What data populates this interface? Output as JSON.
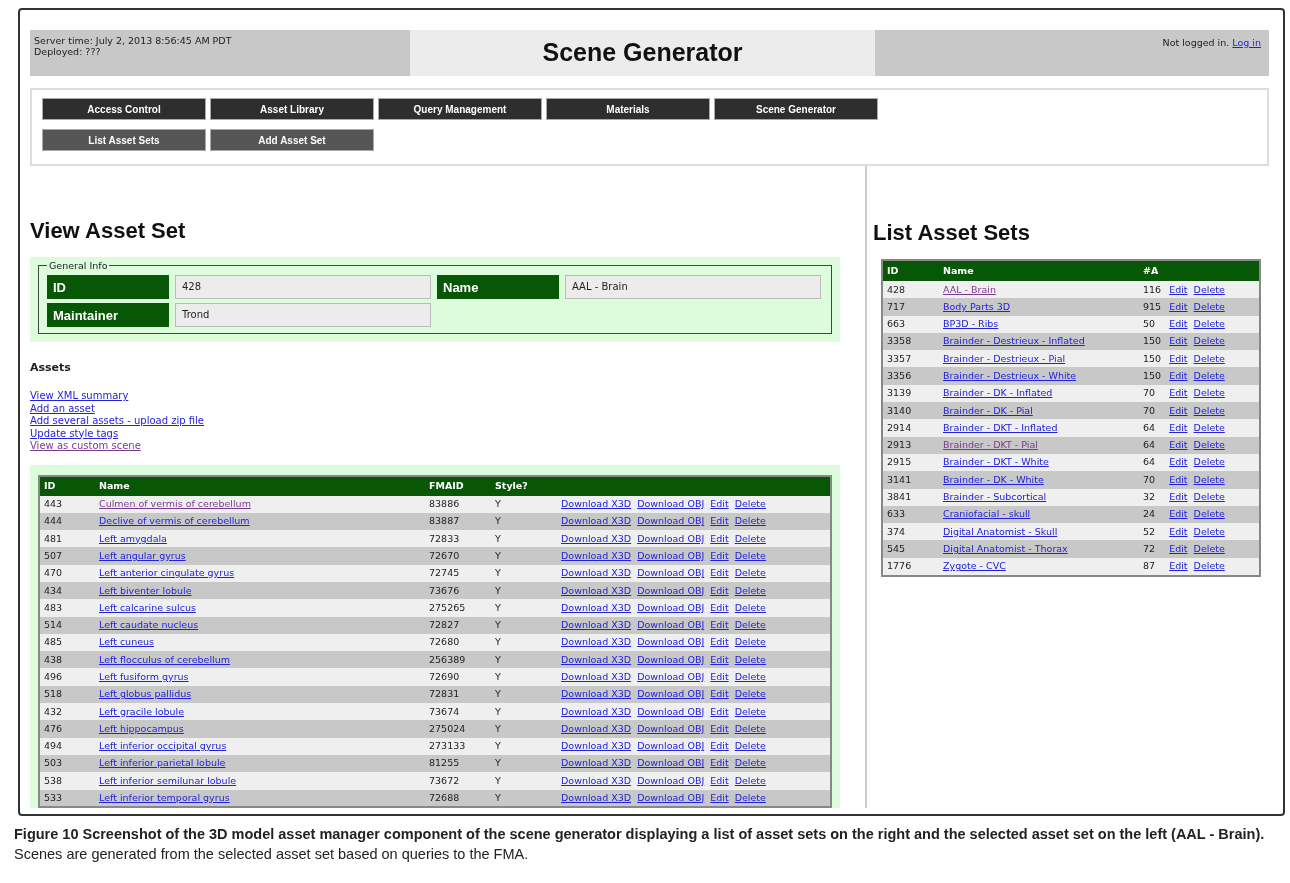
{
  "header": {
    "server_time": "Server time: July 2, 2013 8:56:45 AM PDT",
    "deployed": "Deployed: ???",
    "title": "Scene Generator",
    "login_status": "Not logged in.",
    "login_link": "Log in"
  },
  "nav": {
    "main": [
      "Access Control",
      "Asset Library",
      "Query Management",
      "Materials",
      "Scene Generator"
    ],
    "sub": [
      "List Asset Sets",
      "Add Asset Set"
    ]
  },
  "view": {
    "heading": "View Asset Set",
    "general_info": {
      "legend": "General Info",
      "fields": [
        {
          "label": "ID",
          "value": "428"
        },
        {
          "label": "Name",
          "value": "AAL - Brain"
        },
        {
          "label": "Maintainer",
          "value": "Trond"
        }
      ]
    },
    "assets_heading": "Assets",
    "links": [
      {
        "text": "View XML summary",
        "visited": false
      },
      {
        "text": "Add an asset",
        "visited": false
      },
      {
        "text": "Add several assets - upload zip file",
        "visited": false
      },
      {
        "text": "Update style tags",
        "visited": false
      },
      {
        "text": "View as custom scene",
        "visited": true
      }
    ],
    "table": {
      "columns": [
        "ID",
        "Name",
        "FMAID",
        "Style?"
      ],
      "rows": [
        {
          "id": "443",
          "name": "Culmen of vermis of cerebellum",
          "fmaid": "83886",
          "style": "Y",
          "visited": true,
          "actions": [
            "Download X3D",
            "Download OBJ",
            "Edit",
            "Delete"
          ]
        },
        {
          "id": "444",
          "name": "Declive of vermis of cerebellum",
          "fmaid": "83887",
          "style": "Y",
          "visited": false,
          "actions": [
            "Download X3D",
            "Download OBJ",
            "Edit",
            "Delete"
          ]
        },
        {
          "id": "481",
          "name": "Left amygdala",
          "fmaid": "72833",
          "style": "Y",
          "visited": false,
          "actions": [
            "Download X3D",
            "Download OBJ",
            "Edit",
            "Delete"
          ]
        },
        {
          "id": "507",
          "name": "Left angular gyrus",
          "fmaid": "72670",
          "style": "Y",
          "visited": false,
          "actions": [
            "Download X3D",
            "Download OBJ",
            "Edit",
            "Delete"
          ]
        },
        {
          "id": "470",
          "name": "Left anterior cingulate gyrus",
          "fmaid": "72745",
          "style": "Y",
          "visited": false,
          "actions": [
            "Download X3D",
            "Download OBJ",
            "Edit",
            "Delete"
          ]
        },
        {
          "id": "434",
          "name": "Left biventer lobule",
          "fmaid": "73676",
          "style": "Y",
          "visited": false,
          "actions": [
            "Download X3D",
            "Download OBJ",
            "Edit",
            "Delete"
          ]
        },
        {
          "id": "483",
          "name": "Left calcarine sulcus",
          "fmaid": "275265",
          "style": "Y",
          "visited": false,
          "actions": [
            "Download X3D",
            "Download OBJ",
            "Edit",
            "Delete"
          ]
        },
        {
          "id": "514",
          "name": "Left caudate nucleus",
          "fmaid": "72827",
          "style": "Y",
          "visited": false,
          "actions": [
            "Download X3D",
            "Download OBJ",
            "Edit",
            "Delete"
          ]
        },
        {
          "id": "485",
          "name": "Left cuneus",
          "fmaid": "72680",
          "style": "Y",
          "visited": false,
          "actions": [
            "Download X3D",
            "Download OBJ",
            "Edit",
            "Delete"
          ]
        },
        {
          "id": "438",
          "name": "Left flocculus of cerebellum",
          "fmaid": "256389",
          "style": "Y",
          "visited": false,
          "actions": [
            "Download X3D",
            "Download OBJ",
            "Edit",
            "Delete"
          ]
        },
        {
          "id": "496",
          "name": "Left fusiform gyrus",
          "fmaid": "72690",
          "style": "Y",
          "visited": false,
          "actions": [
            "Download X3D",
            "Download OBJ",
            "Edit",
            "Delete"
          ]
        },
        {
          "id": "518",
          "name": "Left globus pallidus",
          "fmaid": "72831",
          "style": "Y",
          "visited": false,
          "actions": [
            "Download X3D",
            "Download OBJ",
            "Edit",
            "Delete"
          ]
        },
        {
          "id": "432",
          "name": "Left gracile lobule",
          "fmaid": "73674",
          "style": "Y",
          "visited": false,
          "actions": [
            "Download X3D",
            "Download OBJ",
            "Edit",
            "Delete"
          ]
        },
        {
          "id": "476",
          "name": "Left hippocampus",
          "fmaid": "275024",
          "style": "Y",
          "visited": false,
          "actions": [
            "Download X3D",
            "Download OBJ",
            "Edit",
            "Delete"
          ]
        },
        {
          "id": "494",
          "name": "Left inferior occipital gyrus",
          "fmaid": "273133",
          "style": "Y",
          "visited": false,
          "actions": [
            "Download X3D",
            "Download OBJ",
            "Edit",
            "Delete"
          ]
        },
        {
          "id": "503",
          "name": "Left inferior parietal lobule",
          "fmaid": "81255",
          "style": "Y",
          "visited": false,
          "actions": [
            "Download X3D",
            "Download OBJ",
            "Edit",
            "Delete"
          ]
        },
        {
          "id": "538",
          "name": "Left inferior semilunar lobule",
          "fmaid": "73672",
          "style": "Y",
          "visited": false,
          "actions": [
            "Download X3D",
            "Download OBJ",
            "Edit",
            "Delete"
          ]
        },
        {
          "id": "533",
          "name": "Left inferior temporal gyrus",
          "fmaid": "72688",
          "style": "Y",
          "visited": false,
          "actions": [
            "Download X3D",
            "Download OBJ",
            "Edit",
            "Delete"
          ]
        }
      ]
    }
  },
  "list": {
    "heading": "List Asset Sets",
    "table": {
      "columns": [
        "ID",
        "Name",
        "#A"
      ],
      "rows": [
        {
          "id": "428",
          "name": "AAL - Brain",
          "count": "116",
          "visited": true,
          "actions": [
            "Edit",
            "Delete"
          ]
        },
        {
          "id": "717",
          "name": "Body Parts 3D",
          "count": "915",
          "visited": false,
          "actions": [
            "Edit",
            "Delete"
          ]
        },
        {
          "id": "663",
          "name": "BP3D - Ribs",
          "count": "50",
          "visited": false,
          "actions": [
            "Edit",
            "Delete"
          ]
        },
        {
          "id": "3358",
          "name": "Brainder - Destrieux - Inflated",
          "count": "150",
          "visited": false,
          "actions": [
            "Edit",
            "Delete"
          ]
        },
        {
          "id": "3357",
          "name": "Brainder - Destrieux - Pial",
          "count": "150",
          "visited": false,
          "actions": [
            "Edit",
            "Delete"
          ]
        },
        {
          "id": "3356",
          "name": "Brainder - Destrieux - White",
          "count": "150",
          "visited": false,
          "actions": [
            "Edit",
            "Delete"
          ]
        },
        {
          "id": "3139",
          "name": "Brainder - DK - Inflated",
          "count": "70",
          "visited": false,
          "actions": [
            "Edit",
            "Delete"
          ]
        },
        {
          "id": "3140",
          "name": "Brainder - DK - Pial",
          "count": "70",
          "visited": false,
          "actions": [
            "Edit",
            "Delete"
          ]
        },
        {
          "id": "2914",
          "name": "Brainder - DKT - Inflated",
          "count": "64",
          "visited": false,
          "actions": [
            "Edit",
            "Delete"
          ]
        },
        {
          "id": "2913",
          "name": "Brainder - DKT - Pial",
          "count": "64",
          "visited": true,
          "actions": [
            "Edit",
            "Delete"
          ]
        },
        {
          "id": "2915",
          "name": "Brainder - DKT - White",
          "count": "64",
          "visited": false,
          "actions": [
            "Edit",
            "Delete"
          ]
        },
        {
          "id": "3141",
          "name": "Brainder - DK - White",
          "count": "70",
          "visited": false,
          "actions": [
            "Edit",
            "Delete"
          ]
        },
        {
          "id": "3841",
          "name": "Brainder - Subcortical",
          "count": "32",
          "visited": false,
          "actions": [
            "Edit",
            "Delete"
          ]
        },
        {
          "id": "633",
          "name": "Craniofacial - skull",
          "count": "24",
          "visited": false,
          "actions": [
            "Edit",
            "Delete"
          ]
        },
        {
          "id": "374",
          "name": "Digital Anatomist - Skull",
          "count": "52",
          "visited": false,
          "actions": [
            "Edit",
            "Delete"
          ]
        },
        {
          "id": "545",
          "name": "Digital Anatomist - Thorax",
          "count": "72",
          "visited": false,
          "actions": [
            "Edit",
            "Delete"
          ]
        },
        {
          "id": "1776",
          "name": "Zygote - CVC",
          "count": "87",
          "visited": false,
          "actions": [
            "Edit",
            "Delete"
          ]
        }
      ]
    }
  },
  "caption": "**Figure 10 Screenshot of the 3D model asset manager component of the scene generator displaying a list of asset sets on the right and the selected asset set on the left (AAL - Brain).** Scenes are generated from the selected asset set based on queries to the FMA."
}
